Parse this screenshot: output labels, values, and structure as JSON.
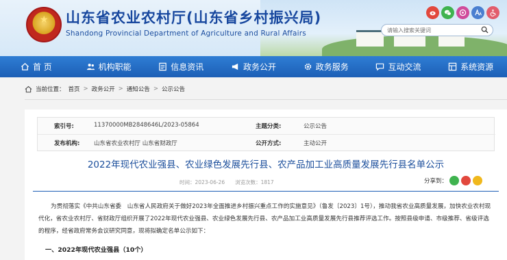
{
  "header": {
    "title": "山东省农业农村厅(山东省乡村振兴局)",
    "subtitle": "Shandong Provincial Department of Agriculture and Rural Affairs",
    "search_placeholder": "请输入搜索关键词"
  },
  "nav": {
    "items": [
      {
        "label": "首 页",
        "icon": "home-icon"
      },
      {
        "label": "机构职能",
        "icon": "people-icon"
      },
      {
        "label": "信息资讯",
        "icon": "info-icon"
      },
      {
        "label": "政务公开",
        "icon": "megaphone-icon"
      },
      {
        "label": "政务服务",
        "icon": "gear-icon"
      },
      {
        "label": "互动交流",
        "icon": "chat-icon"
      },
      {
        "label": "系统资源",
        "icon": "grid-icon"
      }
    ]
  },
  "breadcrumb": {
    "prefix": "当前位置：",
    "items": [
      "首页",
      "政务公开",
      "通知公告",
      "公示公告"
    ]
  },
  "meta": {
    "index_label": "索引号:",
    "index_value": "11370000MB2848646L/2023-05864",
    "category_label": "主题分类:",
    "category_value": "公示公告",
    "issuer_label": "发布机构:",
    "issuer_value": "山东省农业农村厅 山东省财政厅",
    "open_label": "公开方式:",
    "open_value": "主动公开"
  },
  "article": {
    "title": "2022年现代农业强县、农业绿色发展先行县、农产品加工业高质量发展先行县名单公示",
    "info": "时间：2023-06-26　　浏览次数：1817",
    "share_label": "分享到：",
    "body": "为贯彻落实《中共山东省委　山东省人民政府关于做好2023年全面推进乡村振兴重点工作的实施意见》（鲁发〔2023〕1号），推动我省农业高质量发展，加快农业农村现代化，省农业农村厅、省财政厅组织开展了2022年现代农业强县、农业绿色发展先行县、农产品加工业高质量发展先行县推荐评选工作。按照县级申请、市级推荐、省级评选的程序，经省政府常务会议研究同意，现将拟确定名单公示如下：",
    "section1": "一、2022年现代农业强县（10个）"
  },
  "colors": {
    "brand_blue": "#1c5fb6",
    "title_blue": "#17479e",
    "header_bg": "#e8f2fb"
  }
}
